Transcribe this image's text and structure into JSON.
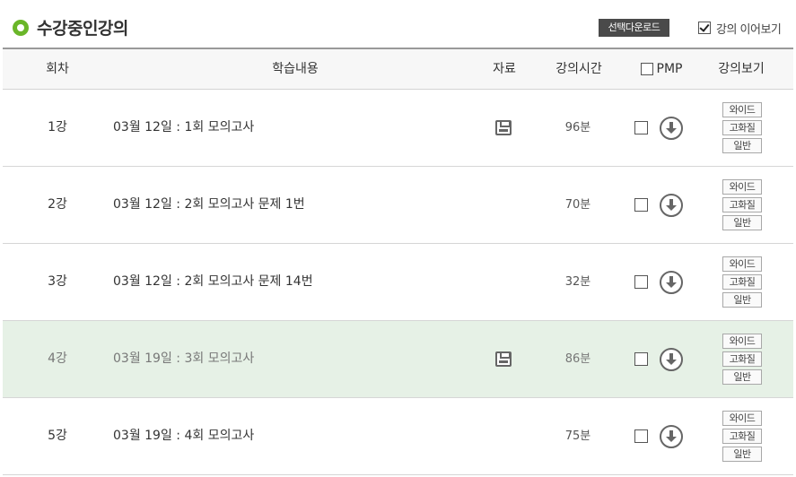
{
  "header": {
    "title": "수강중인강의",
    "download_button": "선택다운로드",
    "continue_label": "강의 이어보기",
    "continue_checked": true
  },
  "columns": {
    "num": "회차",
    "content": "학습내용",
    "material": "자료",
    "time": "강의시간",
    "pmp": "PMP",
    "view": "강의보기"
  },
  "view_buttons": {
    "wide": "와이드",
    "hd": "고화질",
    "normal": "일반"
  },
  "rows": [
    {
      "num": "1강",
      "title": "03월 12일 : 1회 모의고사",
      "material": true,
      "time": "96분",
      "highlight": false
    },
    {
      "num": "2강",
      "title": "03월 12일 : 2회 모의고사 문제 1번",
      "material": false,
      "time": "70분",
      "highlight": false
    },
    {
      "num": "3강",
      "title": "03월 12일 : 2회 모의고사 문제 14번",
      "material": false,
      "time": "32분",
      "highlight": false
    },
    {
      "num": "4강",
      "title": "03월 19일 : 3회 모의고사",
      "material": true,
      "time": "86분",
      "highlight": true
    },
    {
      "num": "5강",
      "title": "03월 19일 : 4회 모의고사",
      "material": false,
      "time": "75분",
      "highlight": false
    }
  ]
}
